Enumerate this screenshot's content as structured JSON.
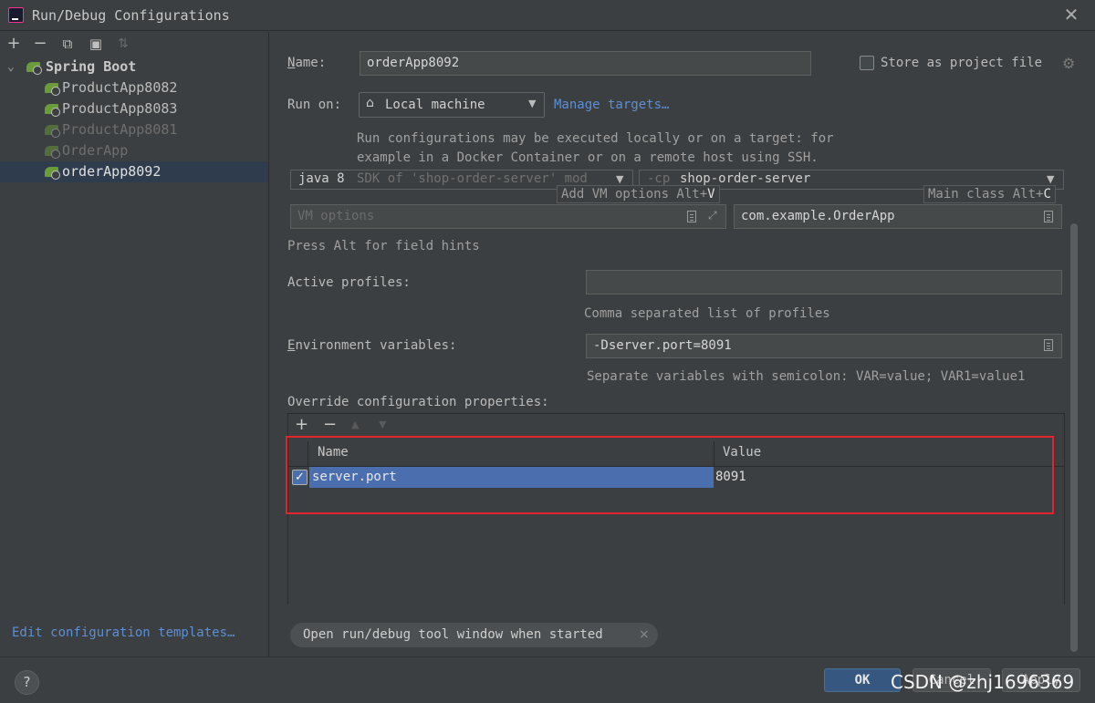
{
  "window": {
    "title": "Run/Debug Configurations",
    "close_glyph": "✕"
  },
  "left": {
    "toolbar": {
      "add": "+",
      "remove": "−",
      "copy": "⧉",
      "folder": "▣",
      "sort": "⇅"
    },
    "group": {
      "label": "Spring Boot",
      "expanded_glyph": "⌄"
    },
    "items": [
      {
        "label": "ProductApp8082",
        "dim": false
      },
      {
        "label": "ProductApp8083",
        "dim": false
      },
      {
        "label": "ProductApp8081",
        "dim": true
      },
      {
        "label": "OrderApp",
        "dim": true
      },
      {
        "label": "orderApp8092",
        "dim": false,
        "selected": true
      }
    ],
    "edit_templates": "Edit configuration templates…"
  },
  "form": {
    "name_label": "Name:",
    "name_value": "orderApp8092",
    "store_label": "Store as project file",
    "run_on_label": "Run on:",
    "run_on_value": "Local machine",
    "manage_targets": "Manage targets…",
    "run_hint_1": "Run configurations may be executed locally or on a target: for",
    "run_hint_2": "example in a Docker Container or on a remote host using SSH.",
    "jdk_value": "java 8",
    "jdk_hint": "SDK of 'shop-order-server' mod",
    "cp_prefix": "-cp",
    "cp_value": "shop-order-server",
    "vm_tooltip": "Add VM options Alt+",
    "vm_tooltip_key": "V",
    "main_tooltip": "Main class Alt+",
    "main_tooltip_key": "C",
    "vm_placeholder": "VM options",
    "main_class": "com.example.OrderApp",
    "field_hints": "Press Alt for field hints",
    "active_profiles_label": "Active profiles:",
    "active_profiles_value": "",
    "profiles_hint": "Comma separated list of profiles",
    "env_label": "Environment variables:",
    "env_value": "-Dserver.port=8091",
    "env_hint": "Separate variables with semicolon: VAR=value; VAR1=value1",
    "override_label": "Override configuration properties:"
  },
  "table": {
    "toolbar": {
      "add": "+",
      "remove": "−",
      "up": "▲",
      "down": "▼"
    },
    "columns": [
      "Name",
      "Value"
    ],
    "rows": [
      {
        "checked": true,
        "name": "server.port",
        "value": "8091"
      }
    ]
  },
  "chip": {
    "label": "Open run/debug tool window when started",
    "close": "×"
  },
  "footer": {
    "help": "?",
    "ok": "OK",
    "cancel": "Cancel",
    "apply": "Apply"
  },
  "watermark": "CSDN @zhj1696369",
  "colors": {
    "accent": "#365880",
    "selection": "#4b6eaf",
    "link": "#5c8fd3",
    "highlight_box": "#e0262a"
  }
}
